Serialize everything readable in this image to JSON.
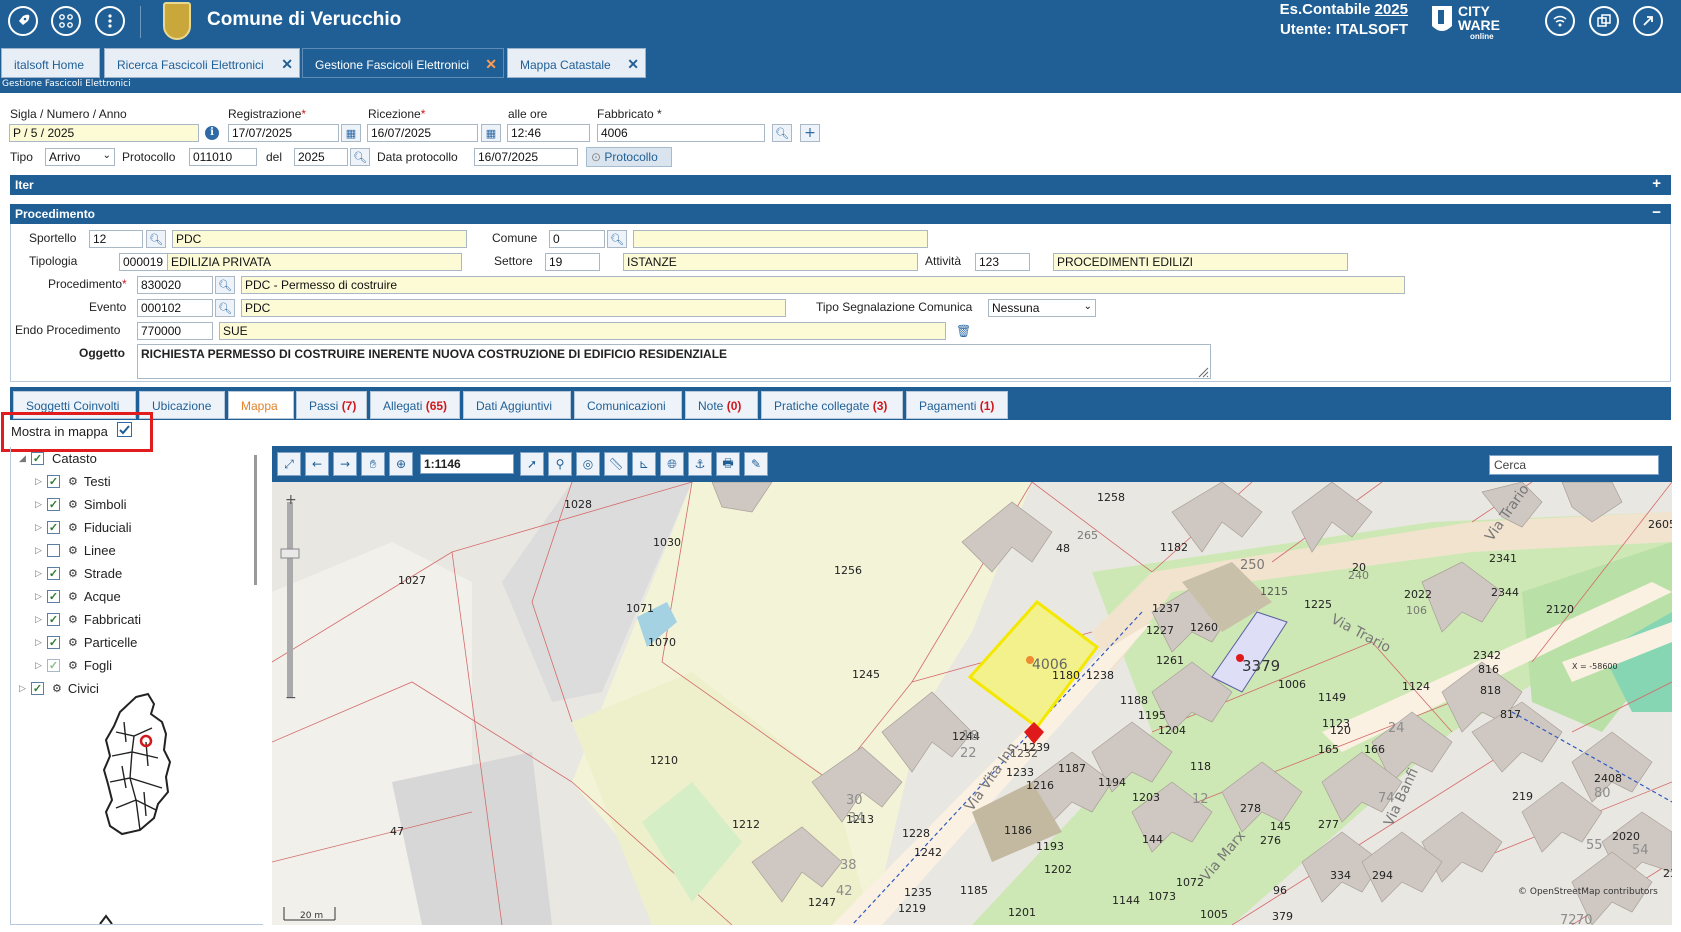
{
  "topbar": {
    "app_title": "Comune di Verucchio",
    "es_label": "Es.Contabile",
    "es_year": "2025",
    "user_line": "Utente: ITALSOFT",
    "logo_line1": "CITY",
    "logo_line2": "WARE",
    "logo_line3": "online"
  },
  "tabs": [
    {
      "label": "italsoft Home"
    },
    {
      "label": "Ricerca Fascicoli Elettronici",
      "close": "✕"
    },
    {
      "label": "Gestione Fascicoli Elettronici",
      "close": "✕"
    },
    {
      "label": "Mappa Catastale",
      "close": "✕"
    }
  ],
  "page_subtitle": "Gestione Fascicoli Elettronici",
  "form": {
    "sigla_label": "Sigla / Numero / Anno",
    "sigla_value": "P / 5 / 2025",
    "registrazione_label": "Registrazione",
    "registrazione_value": "17/07/2025",
    "ricezione_label": "Ricezione",
    "ricezione_value": "16/07/2025",
    "alle_ore_label": "alle ore",
    "alle_ore_value": "12:46",
    "fabbricato_label": "Fabbricato *",
    "fabbricato_value": "4006",
    "tipo_label": "Tipo",
    "tipo_value": "Arrivo",
    "protocollo_label": "Protocollo",
    "protocollo_value": "011010",
    "del_label": "del",
    "del_value": "2025",
    "data_protocollo_label": "Data protocollo",
    "data_protocollo_value": "16/07/2025",
    "protocollo_button": "Protocollo"
  },
  "iter": {
    "title": "Iter",
    "toggle": "+"
  },
  "procedimento": {
    "title": "Procedimento",
    "toggle": "−",
    "sportello_label": "Sportello",
    "sportello_code": "12",
    "sportello_desc": "PDC",
    "comune_label": "Comune",
    "comune_code": "0",
    "comune_desc": "",
    "tipologia_label": "Tipologia",
    "tipologia_code": "000019",
    "tipologia_desc": "EDILIZIA PRIVATA",
    "settore_label": "Settore",
    "settore_code": "19",
    "settore_desc": "ISTANZE",
    "attivita_label": "Attività",
    "attivita_code": "123",
    "attivita_desc": "PROCEDIMENTI EDILIZI",
    "procedimento_label": "Procedimento",
    "procedimento_code": "830020",
    "procedimento_desc": "PDC - Permesso di costruire",
    "evento_label": "Evento",
    "evento_code": "000102",
    "evento_desc": "PDC",
    "tipo_segn_label": "Tipo Segnalazione Comunica",
    "tipo_segn_value": "Nessuna",
    "endo_label": "Endo Procedimento",
    "endo_code": "770000",
    "endo_desc": "SUE",
    "oggetto_label": "Oggetto",
    "oggetto_value": "RICHIESTA PERMESSO DI COSTRUIRE INERENTE NUOVA COSTRUZIONE DI EDIFICIO RESIDENZIALE"
  },
  "detail_tabs": [
    {
      "label": "Soggetti Coinvolti",
      "count": ""
    },
    {
      "label": "Ubicazione",
      "count": ""
    },
    {
      "label": "Mappa",
      "count": ""
    },
    {
      "label": "Passi",
      "count": "(7)"
    },
    {
      "label": "Allegati",
      "count": "(65)"
    },
    {
      "label": "Dati Aggiuntivi",
      "count": ""
    },
    {
      "label": "Comunicazioni",
      "count": ""
    },
    {
      "label": "Note",
      "count": "(0)"
    },
    {
      "label": "Pratiche collegate",
      "count": "(3)"
    },
    {
      "label": "Pagamenti",
      "count": "(1)"
    }
  ],
  "mostra_in_mappa": {
    "label": "Mostra in mappa",
    "checked": true
  },
  "layers": [
    {
      "label": "Catasto",
      "checked": true,
      "level": 0,
      "expanded": true
    },
    {
      "label": "Testi",
      "checked": true,
      "level": 1
    },
    {
      "label": "Simboli",
      "checked": true,
      "level": 1
    },
    {
      "label": "Fiduciali",
      "checked": true,
      "level": 1
    },
    {
      "label": "Linee",
      "checked": false,
      "level": 1
    },
    {
      "label": "Strade",
      "checked": true,
      "level": 1
    },
    {
      "label": "Acque",
      "checked": true,
      "level": 1
    },
    {
      "label": "Fabbricati",
      "checked": true,
      "level": 1
    },
    {
      "label": "Particelle",
      "checked": true,
      "level": 1
    },
    {
      "label": "Fogli",
      "checked": true,
      "level": 1,
      "dim": true
    },
    {
      "label": "Civici",
      "checked": true,
      "level": 0
    }
  ],
  "map": {
    "scale": "1:1146",
    "search_placeholder": "Cerca",
    "scalebar": "20 m",
    "attribution": "© OpenStreetMap contributors",
    "coord_x": "X =   -58600",
    "street_labels": [
      "Via Trario",
      "Via Trario",
      "Via Vita Inn",
      "Via Banfi",
      "Via Marx"
    ],
    "parcel_labels": [
      "1028",
      "1030",
      "1027",
      "1256",
      "1071",
      "1070",
      "1245",
      "1210",
      "1212",
      "47",
      "4006",
      "3379",
      "48",
      "265",
      "1258",
      "1182",
      "250",
      "20",
      "240",
      "1215",
      "2022",
      "106",
      "1225",
      "2341",
      "2344",
      "2120",
      "2605",
      "1237",
      "1227",
      "1260",
      "1261",
      "1180",
      "1238",
      "1188",
      "1195",
      "1204",
      "1006",
      "1149",
      "1124",
      "2342",
      "816",
      "818",
      "1244",
      "1239",
      "1232",
      "1233",
      "1216",
      "1187",
      "1194",
      "1203",
      "118",
      "120",
      "166",
      "165",
      "1123",
      "817",
      "219",
      "2408",
      "1213",
      "1228",
      "1242",
      "1186",
      "1193",
      "1202",
      "278",
      "145",
      "276",
      "277",
      "144",
      "74",
      "2020",
      "1185",
      "1235",
      "1219",
      "1201",
      "1144",
      "1073",
      "1005",
      "1072",
      "96",
      "379",
      "334",
      "294",
      "1247",
      "42",
      "38",
      "30",
      "34",
      "22",
      "18",
      "24",
      "12",
      "23",
      "55",
      "80",
      "70"
    ]
  },
  "colors": {
    "brand": "#1f5f96",
    "accent": "#e3822a",
    "count_red": "#d0191c",
    "parcel_highlight": "#f0f08c",
    "parcel_3379": "#dedff6"
  }
}
